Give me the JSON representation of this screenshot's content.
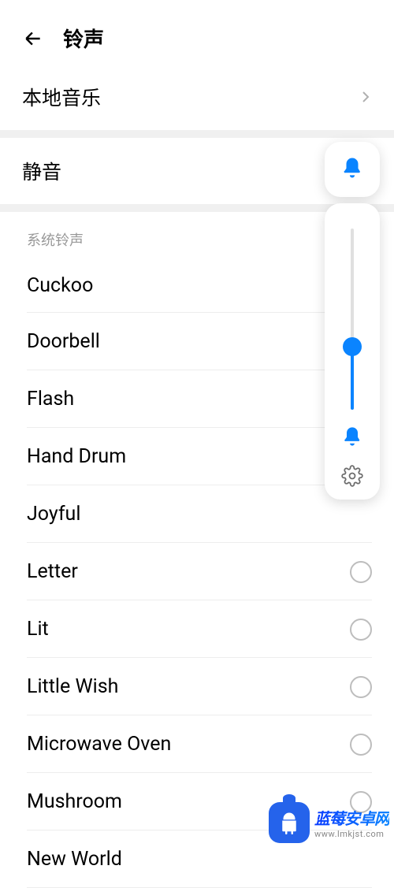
{
  "header": {
    "title": "铃声"
  },
  "local_music": {
    "label": "本地音乐"
  },
  "silent": {
    "label": "静音"
  },
  "system_section": {
    "header": "系统铃声",
    "items": [
      {
        "label": "Cuckoo"
      },
      {
        "label": "Doorbell"
      },
      {
        "label": "Flash"
      },
      {
        "label": "Hand Drum"
      },
      {
        "label": "Joyful"
      },
      {
        "label": "Letter"
      },
      {
        "label": "Lit"
      },
      {
        "label": "Little Wish"
      },
      {
        "label": "Microwave Oven"
      },
      {
        "label": "Mushroom"
      },
      {
        "label": "New World"
      }
    ]
  },
  "volume": {
    "fill_percent": 35,
    "thumb_percent": 35
  },
  "watermark": {
    "main": "蓝莓安卓网",
    "sub": "www.lmkjst.com"
  }
}
